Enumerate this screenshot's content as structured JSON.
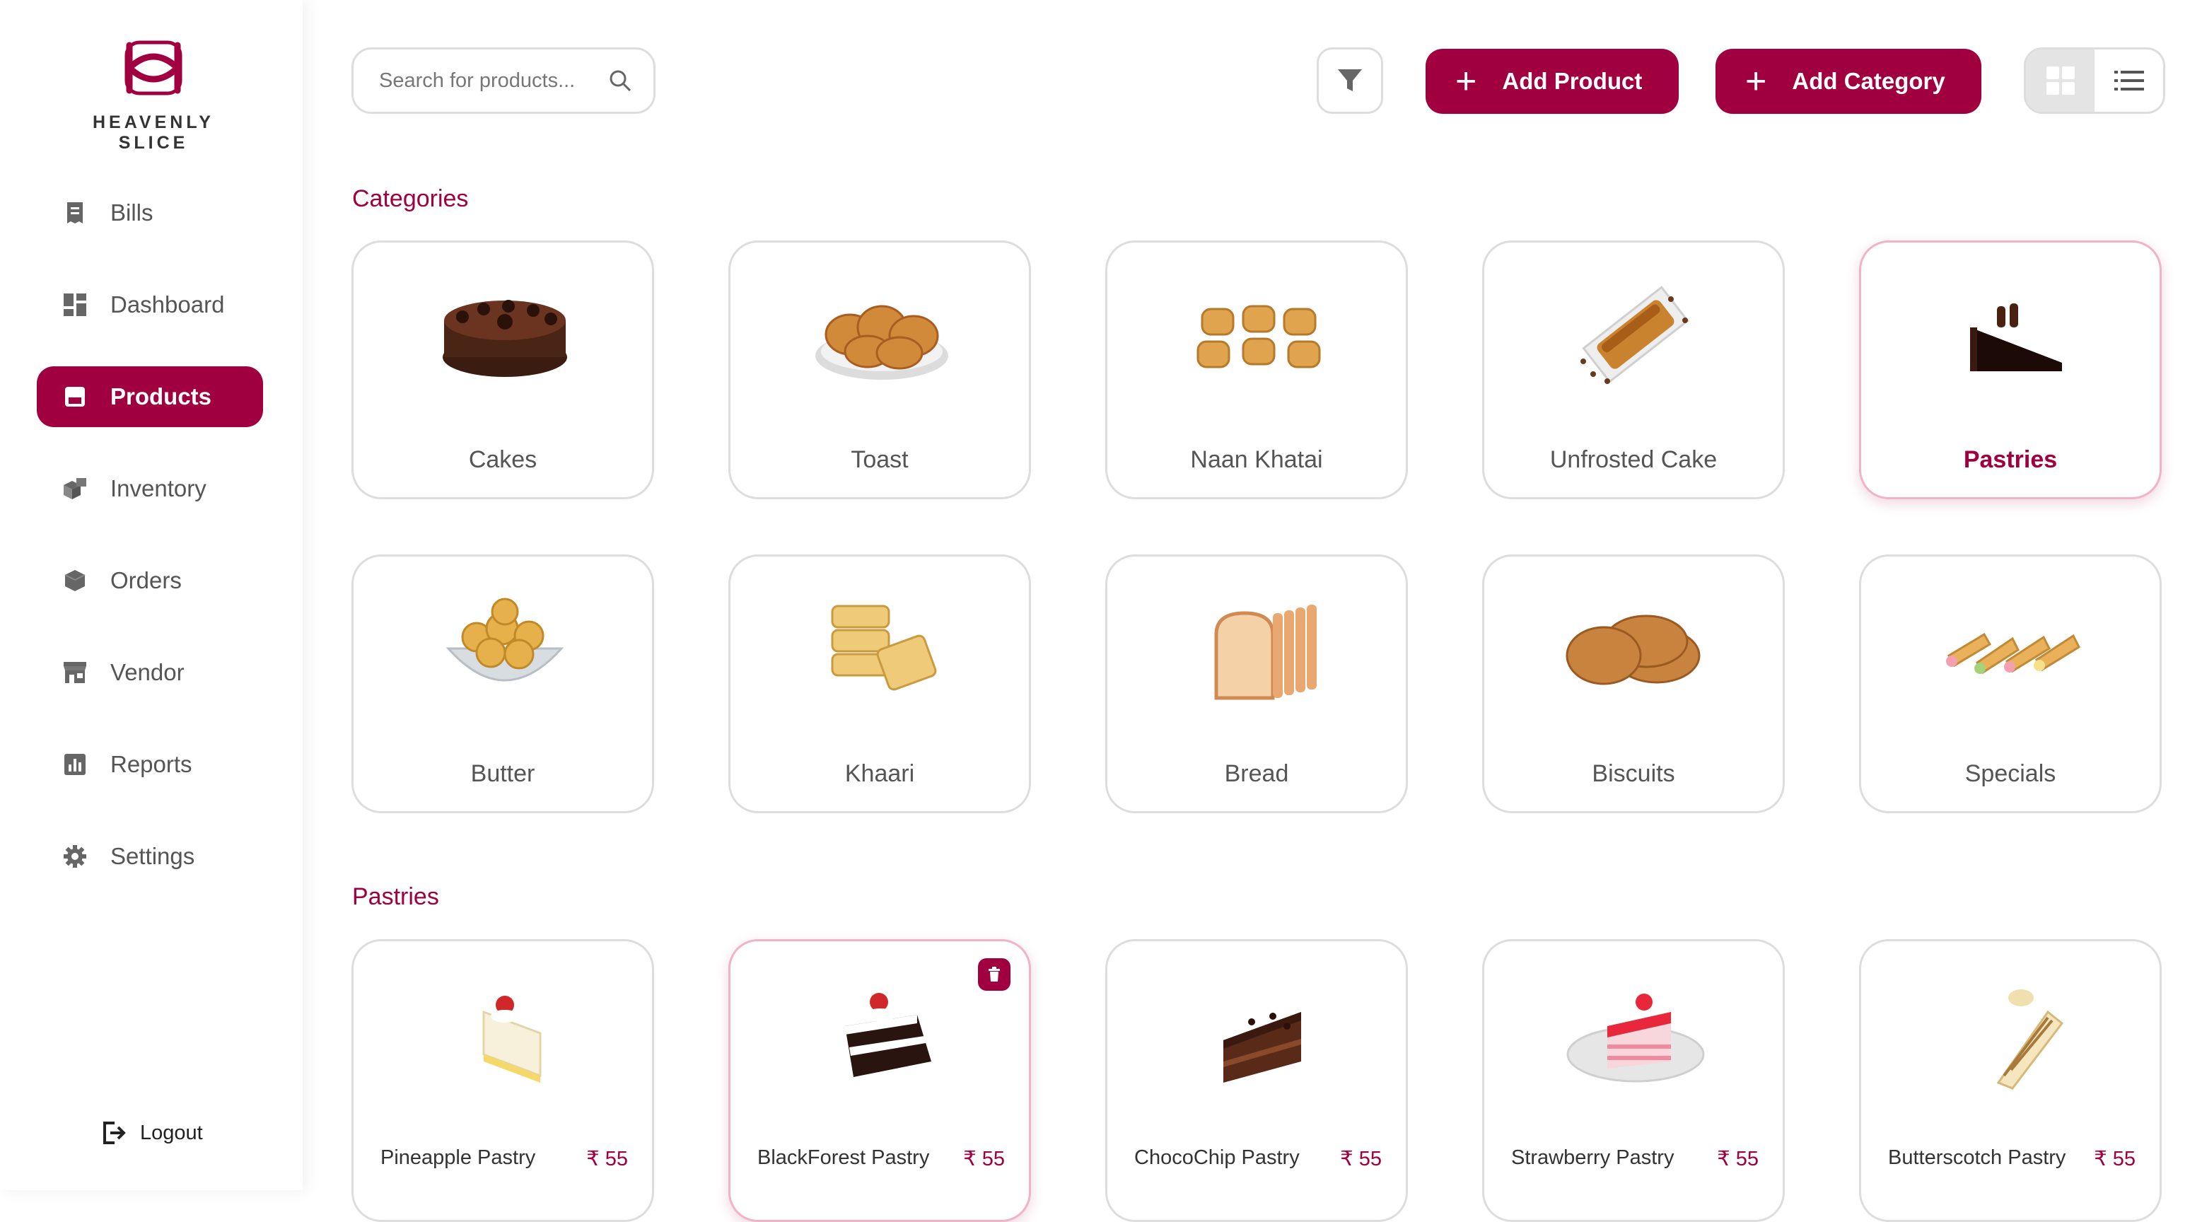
{
  "brand": {
    "name": "HEAVENLY SLICE",
    "color": "#a0003f"
  },
  "sidebar": {
    "items": [
      {
        "label": "Bills",
        "icon": "receipt-icon"
      },
      {
        "label": "Dashboard",
        "icon": "dashboard-icon"
      },
      {
        "label": "Products",
        "icon": "products-icon",
        "active": true
      },
      {
        "label": "Inventory",
        "icon": "boxes-icon"
      },
      {
        "label": "Orders",
        "icon": "package-icon"
      },
      {
        "label": "Vendor",
        "icon": "store-icon"
      },
      {
        "label": "Reports",
        "icon": "bar-chart-icon"
      },
      {
        "label": "Settings",
        "icon": "gear-icon"
      }
    ],
    "logout_label": "Logout"
  },
  "toolbar": {
    "search_placeholder": "Search for products...",
    "add_product_label": "Add Product",
    "add_category_label": "Add Category",
    "view_mode": "grid"
  },
  "categories": {
    "title": "Categories",
    "selected": "Pastries",
    "items": [
      {
        "label": "Cakes"
      },
      {
        "label": "Toast"
      },
      {
        "label": "Naan Khatai"
      },
      {
        "label": "Unfrosted Cake"
      },
      {
        "label": "Pastries"
      },
      {
        "label": "Butter"
      },
      {
        "label": "Khaari"
      },
      {
        "label": "Bread"
      },
      {
        "label": "Biscuits"
      },
      {
        "label": "Specials"
      }
    ]
  },
  "products": {
    "title": "Pastries",
    "currency": "₹",
    "items": [
      {
        "name": "Pineapple Pastry",
        "price": "₹ 55"
      },
      {
        "name": "BlackForest Pastry",
        "price": "₹ 55"
      },
      {
        "name": "ChocoChip Pastry",
        "price": "₹ 55"
      },
      {
        "name": "Strawberry Pastry",
        "price": "₹ 55"
      },
      {
        "name": "Butterscotch Pastry",
        "price": "₹ 55"
      }
    ]
  }
}
